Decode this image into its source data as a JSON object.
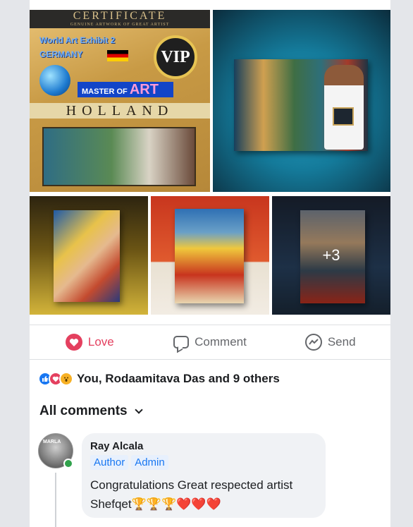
{
  "photos": {
    "certificate": {
      "banner": "CERTIFICATE",
      "banner_sub": "GENUINE ARTWORK OF GREAT ARTIST",
      "exhibit": "World Art Exhibit 2",
      "country": "GERMANY",
      "vip": "VIP",
      "master_of": "MASTER OF",
      "art": "ART",
      "holland": "HOLLAND"
    },
    "more_count": "+3"
  },
  "actions": {
    "love": "Love",
    "comment": "Comment",
    "send": "Send"
  },
  "reactions": {
    "summary": "You, Rodaamitava Das and 9 others"
  },
  "comments": {
    "filter_label": "All comments",
    "items": [
      {
        "author": "Ray Alcala",
        "badges": [
          "Author",
          "Admin"
        ],
        "text": "Congratulations Great respected artist Shefqet🏆🏆🏆❤️❤️❤️"
      }
    ]
  },
  "colors": {
    "love": "#e4405f",
    "like": "#1877f2",
    "online": "#31a24c"
  }
}
